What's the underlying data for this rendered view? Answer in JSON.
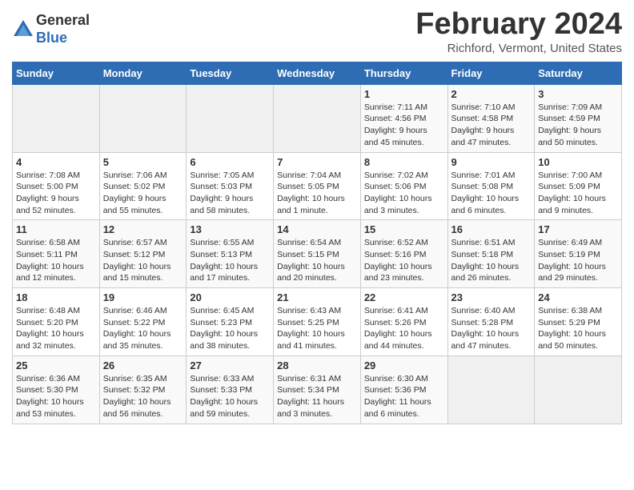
{
  "header": {
    "logo_line1": "General",
    "logo_line2": "Blue",
    "month_year": "February 2024",
    "location": "Richford, Vermont, United States"
  },
  "days_of_week": [
    "Sunday",
    "Monday",
    "Tuesday",
    "Wednesday",
    "Thursday",
    "Friday",
    "Saturday"
  ],
  "weeks": [
    [
      {
        "day": "",
        "info": ""
      },
      {
        "day": "",
        "info": ""
      },
      {
        "day": "",
        "info": ""
      },
      {
        "day": "",
        "info": ""
      },
      {
        "day": "1",
        "info": "Sunrise: 7:11 AM\nSunset: 4:56 PM\nDaylight: 9 hours\nand 45 minutes."
      },
      {
        "day": "2",
        "info": "Sunrise: 7:10 AM\nSunset: 4:58 PM\nDaylight: 9 hours\nand 47 minutes."
      },
      {
        "day": "3",
        "info": "Sunrise: 7:09 AM\nSunset: 4:59 PM\nDaylight: 9 hours\nand 50 minutes."
      }
    ],
    [
      {
        "day": "4",
        "info": "Sunrise: 7:08 AM\nSunset: 5:00 PM\nDaylight: 9 hours\nand 52 minutes."
      },
      {
        "day": "5",
        "info": "Sunrise: 7:06 AM\nSunset: 5:02 PM\nDaylight: 9 hours\nand 55 minutes."
      },
      {
        "day": "6",
        "info": "Sunrise: 7:05 AM\nSunset: 5:03 PM\nDaylight: 9 hours\nand 58 minutes."
      },
      {
        "day": "7",
        "info": "Sunrise: 7:04 AM\nSunset: 5:05 PM\nDaylight: 10 hours\nand 1 minute."
      },
      {
        "day": "8",
        "info": "Sunrise: 7:02 AM\nSunset: 5:06 PM\nDaylight: 10 hours\nand 3 minutes."
      },
      {
        "day": "9",
        "info": "Sunrise: 7:01 AM\nSunset: 5:08 PM\nDaylight: 10 hours\nand 6 minutes."
      },
      {
        "day": "10",
        "info": "Sunrise: 7:00 AM\nSunset: 5:09 PM\nDaylight: 10 hours\nand 9 minutes."
      }
    ],
    [
      {
        "day": "11",
        "info": "Sunrise: 6:58 AM\nSunset: 5:11 PM\nDaylight: 10 hours\nand 12 minutes."
      },
      {
        "day": "12",
        "info": "Sunrise: 6:57 AM\nSunset: 5:12 PM\nDaylight: 10 hours\nand 15 minutes."
      },
      {
        "day": "13",
        "info": "Sunrise: 6:55 AM\nSunset: 5:13 PM\nDaylight: 10 hours\nand 17 minutes."
      },
      {
        "day": "14",
        "info": "Sunrise: 6:54 AM\nSunset: 5:15 PM\nDaylight: 10 hours\nand 20 minutes."
      },
      {
        "day": "15",
        "info": "Sunrise: 6:52 AM\nSunset: 5:16 PM\nDaylight: 10 hours\nand 23 minutes."
      },
      {
        "day": "16",
        "info": "Sunrise: 6:51 AM\nSunset: 5:18 PM\nDaylight: 10 hours\nand 26 minutes."
      },
      {
        "day": "17",
        "info": "Sunrise: 6:49 AM\nSunset: 5:19 PM\nDaylight: 10 hours\nand 29 minutes."
      }
    ],
    [
      {
        "day": "18",
        "info": "Sunrise: 6:48 AM\nSunset: 5:20 PM\nDaylight: 10 hours\nand 32 minutes."
      },
      {
        "day": "19",
        "info": "Sunrise: 6:46 AM\nSunset: 5:22 PM\nDaylight: 10 hours\nand 35 minutes."
      },
      {
        "day": "20",
        "info": "Sunrise: 6:45 AM\nSunset: 5:23 PM\nDaylight: 10 hours\nand 38 minutes."
      },
      {
        "day": "21",
        "info": "Sunrise: 6:43 AM\nSunset: 5:25 PM\nDaylight: 10 hours\nand 41 minutes."
      },
      {
        "day": "22",
        "info": "Sunrise: 6:41 AM\nSunset: 5:26 PM\nDaylight: 10 hours\nand 44 minutes."
      },
      {
        "day": "23",
        "info": "Sunrise: 6:40 AM\nSunset: 5:28 PM\nDaylight: 10 hours\nand 47 minutes."
      },
      {
        "day": "24",
        "info": "Sunrise: 6:38 AM\nSunset: 5:29 PM\nDaylight: 10 hours\nand 50 minutes."
      }
    ],
    [
      {
        "day": "25",
        "info": "Sunrise: 6:36 AM\nSunset: 5:30 PM\nDaylight: 10 hours\nand 53 minutes."
      },
      {
        "day": "26",
        "info": "Sunrise: 6:35 AM\nSunset: 5:32 PM\nDaylight: 10 hours\nand 56 minutes."
      },
      {
        "day": "27",
        "info": "Sunrise: 6:33 AM\nSunset: 5:33 PM\nDaylight: 10 hours\nand 59 minutes."
      },
      {
        "day": "28",
        "info": "Sunrise: 6:31 AM\nSunset: 5:34 PM\nDaylight: 11 hours\nand 3 minutes."
      },
      {
        "day": "29",
        "info": "Sunrise: 6:30 AM\nSunset: 5:36 PM\nDaylight: 11 hours\nand 6 minutes."
      },
      {
        "day": "",
        "info": ""
      },
      {
        "day": "",
        "info": ""
      }
    ]
  ]
}
